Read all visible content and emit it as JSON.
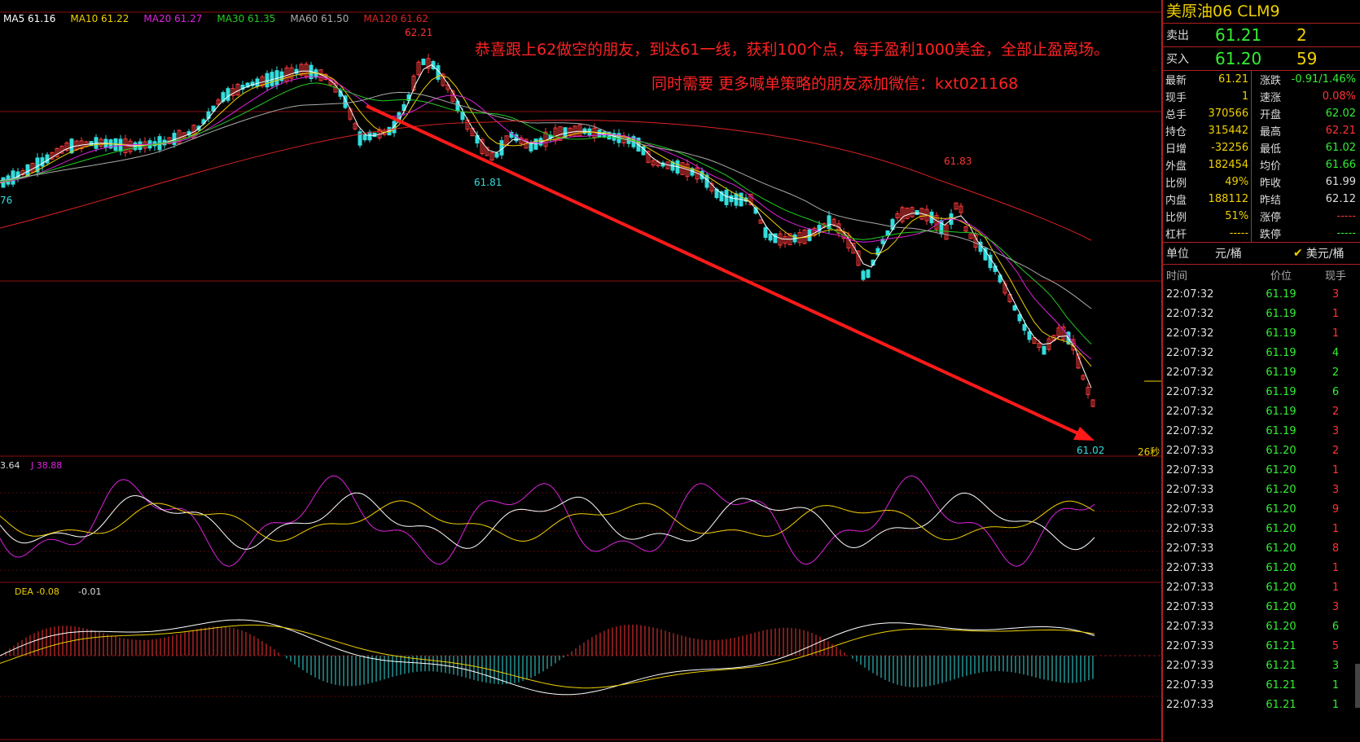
{
  "colors": {
    "up": "#ff3b3b",
    "down": "#33dddd",
    "ma5": "#ffffff",
    "ma10": "#f0d000",
    "ma20": "#dd22dd",
    "ma30": "#22cc22",
    "ma60": "#aaaaaa",
    "ma120": "#dd2222",
    "green": "#33ee33",
    "red": "#ff3333",
    "yellow": "#f0d000"
  },
  "ma_legend": [
    {
      "label": "MA5 61.16",
      "color": "#ffffff"
    },
    {
      "label": "MA10 61.22",
      "color": "#f0d000"
    },
    {
      "label": "MA20 61.27",
      "color": "#dd22dd"
    },
    {
      "label": "MA30 61.35",
      "color": "#22cc22"
    },
    {
      "label": "MA60 61.50",
      "color": "#aaaaaa"
    },
    {
      "label": "MA120 61.62",
      "color": "#dd2222"
    }
  ],
  "chart": {
    "high_label": "62.21",
    "low_label_1": "61.81",
    "high_label_2": "61.83",
    "low_label_2": "61.02",
    "left_label": "76",
    "countdown": "26秒",
    "promo_line1": "恭喜跟上62做空的朋友，到达61一线，获利100个点，每手盈利1000美金，全部止盈离场。",
    "promo_line2": "同时需要 更多喊单策略的朋友添加微信：kxt021168",
    "kdj_label_a": "3.64",
    "kdj_label_j": "J 38.88",
    "macd_label_dea": "DEA -0.08",
    "macd_label_m": "-0.01"
  },
  "panel": {
    "title": "美原油06  CLM9",
    "sell": {
      "label": "卖出",
      "price": "61.21",
      "vol": "2"
    },
    "buy": {
      "label": "买入",
      "price": "61.20",
      "vol": "59"
    },
    "stats": [
      {
        "k1": "最新",
        "v1": "61.21",
        "c1": "#f0d000",
        "k2": "涨跌",
        "v2": "-0.91/1.46%",
        "c2": "#33ee33"
      },
      {
        "k1": "现手",
        "v1": "1",
        "c1": "#f0d000",
        "k2": "速涨",
        "v2": "0.08%",
        "c2": "#ff3333"
      },
      {
        "k1": "总手",
        "v1": "370566",
        "c1": "#f0d000",
        "k2": "开盘",
        "v2": "62.02",
        "c2": "#33ee33"
      },
      {
        "k1": "持仓",
        "v1": "315442",
        "c1": "#f0d000",
        "k2": "最高",
        "v2": "62.21",
        "c2": "#ff3333"
      },
      {
        "k1": "日增",
        "v1": "-32256",
        "c1": "#f0d000",
        "k2": "最低",
        "v2": "61.02",
        "c2": "#33ee33"
      },
      {
        "k1": "外盘",
        "v1": "182454",
        "c1": "#f0d000",
        "k2": "均价",
        "v2": "61.66",
        "c2": "#33ee33"
      },
      {
        "k1": "比例",
        "v1": "49%",
        "c1": "#f0d000",
        "k2": "昨收",
        "v2": "61.99",
        "c2": "#dddddd"
      },
      {
        "k1": "内盘",
        "v1": "188112",
        "c1": "#f0d000",
        "k2": "昨结",
        "v2": "62.12",
        "c2": "#dddddd"
      },
      {
        "k1": "比例",
        "v1": "51%",
        "c1": "#f0d000",
        "k2": "涨停",
        "v2": "-----",
        "c2": "#ff3333"
      },
      {
        "k1": "杠杆",
        "v1": "-----",
        "c1": "#f0d000",
        "k2": "跌停",
        "v2": "-----",
        "c2": "#33ee33"
      }
    ],
    "unit_label": "单位",
    "unit_a": "元/桶",
    "unit_b": "美元/桶",
    "tick_headers": {
      "time": "时间",
      "price": "价位",
      "qty": "现手"
    },
    "ticks": [
      {
        "t": "22:07:32",
        "p": "61.19",
        "q": "3",
        "c": "#ff3333"
      },
      {
        "t": "22:07:32",
        "p": "61.19",
        "q": "1",
        "c": "#ff3333"
      },
      {
        "t": "22:07:32",
        "p": "61.19",
        "q": "1",
        "c": "#ff3333"
      },
      {
        "t": "22:07:32",
        "p": "61.19",
        "q": "4",
        "c": "#33ee33"
      },
      {
        "t": "22:07:32",
        "p": "61.19",
        "q": "2",
        "c": "#33ee33"
      },
      {
        "t": "22:07:32",
        "p": "61.19",
        "q": "6",
        "c": "#33ee33"
      },
      {
        "t": "22:07:32",
        "p": "61.19",
        "q": "2",
        "c": "#ff3333"
      },
      {
        "t": "22:07:32",
        "p": "61.19",
        "q": "3",
        "c": "#ff3333"
      },
      {
        "t": "22:07:33",
        "p": "61.20",
        "q": "2",
        "c": "#ff3333"
      },
      {
        "t": "22:07:33",
        "p": "61.20",
        "q": "1",
        "c": "#ff3333"
      },
      {
        "t": "22:07:33",
        "p": "61.20",
        "q": "3",
        "c": "#ff3333"
      },
      {
        "t": "22:07:33",
        "p": "61.20",
        "q": "9",
        "c": "#ff3333"
      },
      {
        "t": "22:07:33",
        "p": "61.20",
        "q": "1",
        "c": "#ff3333"
      },
      {
        "t": "22:07:33",
        "p": "61.20",
        "q": "8",
        "c": "#ff3333"
      },
      {
        "t": "22:07:33",
        "p": "61.20",
        "q": "1",
        "c": "#ff3333"
      },
      {
        "t": "22:07:33",
        "p": "61.20",
        "q": "1",
        "c": "#ff3333"
      },
      {
        "t": "22:07:33",
        "p": "61.20",
        "q": "3",
        "c": "#ff3333"
      },
      {
        "t": "22:07:33",
        "p": "61.20",
        "q": "6",
        "c": "#33ee33"
      },
      {
        "t": "22:07:33",
        "p": "61.21",
        "q": "5",
        "c": "#ff3333"
      },
      {
        "t": "22:07:33",
        "p": "61.21",
        "q": "3",
        "c": "#33ee33"
      },
      {
        "t": "22:07:33",
        "p": "61.21",
        "q": "1",
        "c": "#33ee33"
      },
      {
        "t": "22:07:33",
        "p": "61.21",
        "q": "1",
        "c": "#33ee33"
      }
    ]
  }
}
